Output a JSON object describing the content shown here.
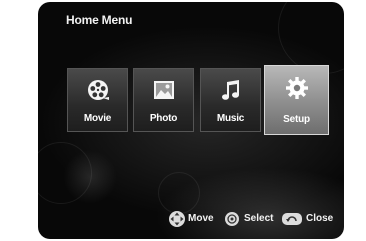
{
  "header": {
    "title": "Home Menu"
  },
  "menu": {
    "items": [
      {
        "label": "Movie",
        "icon": "film-reel-icon"
      },
      {
        "label": "Photo",
        "icon": "photo-icon"
      },
      {
        "label": "Music",
        "icon": "music-note-icon"
      },
      {
        "label": "Setup",
        "icon": "gear-icon"
      }
    ],
    "selected": "Setup"
  },
  "footer": {
    "move_label": "Move",
    "select_label": "Select",
    "close_label": "Close",
    "icons": [
      "dpad-arrows-icon",
      "enter-button-icon",
      "return-button-icon"
    ]
  }
}
